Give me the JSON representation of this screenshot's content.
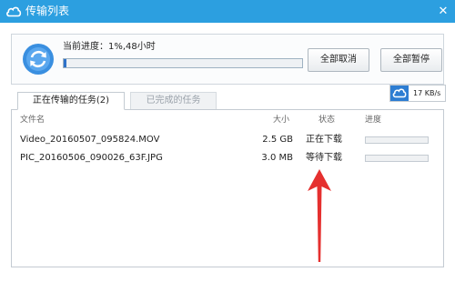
{
  "window": {
    "title": "传输列表",
    "close_glyph": "✕",
    "icon": "cloud-icon",
    "accent": "#2c9fe0"
  },
  "overall": {
    "label": "当前进度：1%,48小时",
    "progress": 0.01,
    "fill_color": "#2e72c9"
  },
  "buttons": {
    "cancel_all": "全部取消",
    "pause_all": "全部暂停"
  },
  "tabs": [
    {
      "label": "正在传输的任务(2)",
      "active": true
    },
    {
      "label": "已完成的任务",
      "active": false
    }
  ],
  "speed": {
    "value": "17 KB/s",
    "icon": "cloud-speed-icon"
  },
  "columns": {
    "name": "文件名",
    "size": "大小",
    "status": "状态",
    "progress": "进度"
  },
  "rows": [
    {
      "name": "Video_20160507_095824.MOV",
      "size": "2.5 GB",
      "status": "正在下载",
      "progress": 0
    },
    {
      "name": "PIC_20160506_090026_63F.JPG",
      "size": "3.0 MB",
      "status": "等待下载",
      "progress": 0
    }
  ],
  "annotation": {
    "icon": "red-arrow-icon",
    "color": "#e5302f"
  }
}
